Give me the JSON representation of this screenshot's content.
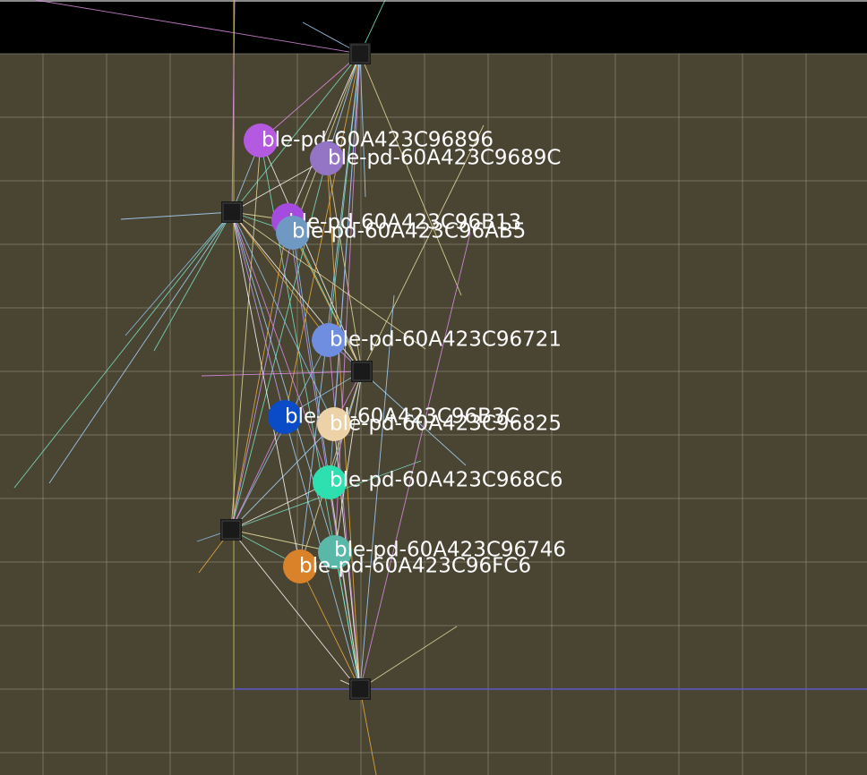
{
  "colors": {
    "background": "#4a4433",
    "grid": "#9a9680",
    "top_bar": "#000000",
    "axis_vertical": "#b8b24a",
    "axis_horizontal": "#5a5ac8",
    "anchor": "#1a1a1a"
  },
  "anchors": [
    {
      "id": "anchor-top"
    },
    {
      "id": "anchor-left-upper"
    },
    {
      "id": "anchor-middle"
    },
    {
      "id": "anchor-left-lower"
    },
    {
      "id": "anchor-bottom"
    }
  ],
  "tags": [
    {
      "label": "ble-pd-60A423C96896",
      "color": "#b35ae0"
    },
    {
      "label": "ble-pd-60A423C9689C",
      "color": "#9474c4"
    },
    {
      "label": "ble-pd-60A423C96B13",
      "color": "#a64be0"
    },
    {
      "label": "ble-pd-60A423C96AB5",
      "color": "#6f98c2"
    },
    {
      "label": "ble-pd-60A423C96721",
      "color": "#6f8ee0"
    },
    {
      "label": "ble-pd-60A423C96B3C",
      "color": "#0a4cc8"
    },
    {
      "label": "ble-pd-60A423C96825",
      "color": "#ecd2a6"
    },
    {
      "label": "ble-pd-60A423C968C6",
      "color": "#2ee0b0"
    },
    {
      "label": "ble-pd-60A423C96746",
      "color": "#5ab8a8"
    },
    {
      "label": "ble-pd-60A423C96FC6",
      "color": "#d9822a"
    }
  ]
}
